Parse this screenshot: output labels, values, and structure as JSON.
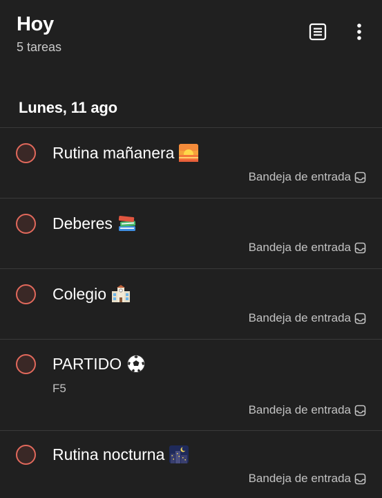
{
  "header": {
    "title": "Hoy",
    "subtitle": "5 tareas",
    "view_icon": "view-list-icon",
    "more_icon": "more-vertical-icon"
  },
  "section": {
    "title": "Lunes, 11 ago"
  },
  "tasks": [
    {
      "name": "Rutina mañanera",
      "emoji": "sunrise-emoji",
      "description": "",
      "project": "Bandeja de entrada"
    },
    {
      "name": "Deberes",
      "emoji": "books-emoji",
      "description": "",
      "project": "Bandeja de entrada"
    },
    {
      "name": "Colegio",
      "emoji": "school-emoji",
      "description": "",
      "project": "Bandeja de entrada"
    },
    {
      "name": "PARTIDO",
      "emoji": "soccer-ball-emoji",
      "description": "F5",
      "project": "Bandeja de entrada"
    },
    {
      "name": "Rutina nocturna",
      "emoji": "night-city-emoji",
      "description": "",
      "project": "Bandeja de entrada"
    }
  ],
  "colors": {
    "background": "#202020",
    "checkbox_border": "#e2695c",
    "divider": "#3a3a3a",
    "secondary_text": "#c2c2c2"
  }
}
